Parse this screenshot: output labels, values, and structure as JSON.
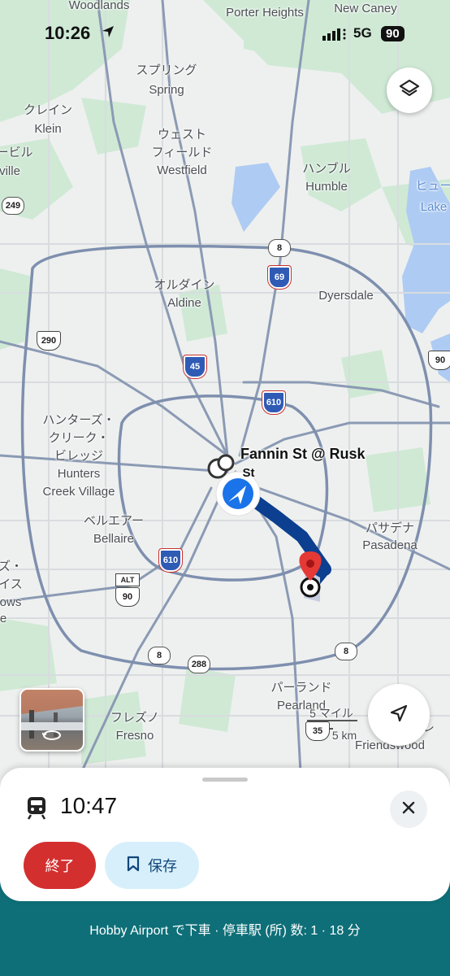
{
  "status_bar": {
    "time": "10:26",
    "network": "5G",
    "battery": "90"
  },
  "map": {
    "places": [
      {
        "key": "woodlands",
        "text": "Woodlands"
      },
      {
        "key": "porter",
        "text": "Porter Heights"
      },
      {
        "key": "newcaney",
        "text": "New Caney"
      },
      {
        "key": "spring_ja",
        "text": "スプリング"
      },
      {
        "key": "spring",
        "text": "Spring"
      },
      {
        "key": "klein_ja",
        "text": "クレイン"
      },
      {
        "key": "klein",
        "text": "Klein"
      },
      {
        "key": "ville_ja",
        "text": "ービル"
      },
      {
        "key": "ville",
        "text": "ville"
      },
      {
        "key": "westfield_ja1",
        "text": "ウェスト"
      },
      {
        "key": "westfield_ja2",
        "text": "フィールド"
      },
      {
        "key": "westfield",
        "text": "Westfield"
      },
      {
        "key": "humble_ja",
        "text": "ハンブル"
      },
      {
        "key": "humble",
        "text": "Humble"
      },
      {
        "key": "lake_ja",
        "text": "ヒュー"
      },
      {
        "key": "lake",
        "text": "Lake"
      },
      {
        "key": "aldine_ja",
        "text": "オルダイン"
      },
      {
        "key": "aldine",
        "text": "Aldine"
      },
      {
        "key": "dyersdale",
        "text": "Dyersdale"
      },
      {
        "key": "hcv_ja1",
        "text": "ハンターズ・"
      },
      {
        "key": "hcv_ja2",
        "text": "クリーク・"
      },
      {
        "key": "hcv_ja3",
        "text": "ビレッジ"
      },
      {
        "key": "hcv1",
        "text": "Hunters"
      },
      {
        "key": "hcv2",
        "text": "Creek Village"
      },
      {
        "key": "bellaire_ja",
        "text": "ベルエアー"
      },
      {
        "key": "bellaire",
        "text": "Bellaire"
      },
      {
        "key": "pasadena_ja",
        "text": "パサデナ"
      },
      {
        "key": "pasadena",
        "text": "Pasadena"
      },
      {
        "key": "left_ja1",
        "text": "ズ・"
      },
      {
        "key": "left_ja2",
        "text": "イス"
      },
      {
        "key": "left_en1",
        "text": "ows"
      },
      {
        "key": "left_en2",
        "text": "e"
      },
      {
        "key": "pearland_ja",
        "text": "パーランド"
      },
      {
        "key": "pearland",
        "text": "Pearland"
      },
      {
        "key": "fresno_ja",
        "text": "フレズノ"
      },
      {
        "key": "fresno",
        "text": "Fresno"
      },
      {
        "key": "friendswood",
        "text": "Friendswood"
      },
      {
        "key": "friend_ja",
        "text": "フレ"
      },
      {
        "key": "scale_mi",
        "text": "5 マイル"
      },
      {
        "key": "scale_km",
        "text": "5 km"
      }
    ],
    "shields": [
      {
        "key": "s249",
        "text": "249",
        "kind": "state"
      },
      {
        "key": "s8a",
        "text": "8",
        "kind": "state"
      },
      {
        "key": "s69",
        "text": "69",
        "kind": "interstate"
      },
      {
        "key": "s290",
        "text": "290",
        "kind": "us"
      },
      {
        "key": "s45",
        "text": "45",
        "kind": "interstate"
      },
      {
        "key": "s610a",
        "text": "610",
        "kind": "interstate"
      },
      {
        "key": "s90a",
        "text": "90",
        "kind": "us"
      },
      {
        "key": "s610b",
        "text": "610",
        "kind": "interstate"
      },
      {
        "key": "salt",
        "text": "ALT",
        "kind": "alt"
      },
      {
        "key": "s90b",
        "text": "90",
        "kind": "us"
      },
      {
        "key": "s8b",
        "text": "8",
        "kind": "state"
      },
      {
        "key": "s288",
        "text": "288",
        "kind": "state"
      },
      {
        "key": "s8c",
        "text": "8",
        "kind": "state"
      },
      {
        "key": "s35",
        "text": "35",
        "kind": "us"
      }
    ],
    "stop_label": "Fannin St @ Rusk",
    "stop_label_tail": "St",
    "colors": {
      "route": "#0c3f8f",
      "pin": "#e53935",
      "user_arrow": "#1a73e8"
    }
  },
  "controls": {
    "layers_icon": "layers-icon",
    "locate_icon": "navigation-arrow-icon",
    "street_view_icon": "street-view-rotate-icon"
  },
  "trip_card": {
    "arrival_time": "10:47",
    "end_label": "終了",
    "save_label": "保存"
  },
  "footer": {
    "text": "Hobby Airport で下車 · 停車駅 (所) 数: 1 · 18 分"
  }
}
